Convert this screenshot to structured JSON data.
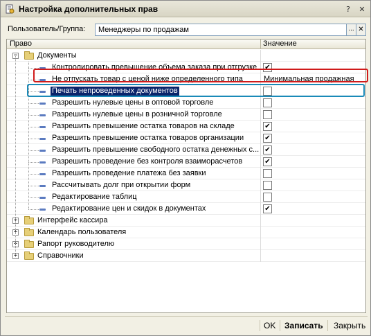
{
  "window": {
    "title": "Настройка дополнительных прав",
    "icon": "document-settings-icon"
  },
  "user": {
    "label": "Пользователь/Группа:",
    "value": "Менеджеры по продажам",
    "select_glyph": "...",
    "clear_glyph": "✕"
  },
  "grid": {
    "columns": [
      "Право",
      "Значение"
    ],
    "rows": [
      {
        "label": "Документы",
        "kind": "folder",
        "expanded": true
      },
      {
        "label": "Контролировать превышение объема заказа при отгрузке",
        "kind": "item",
        "checked": true
      },
      {
        "label": "Не отпускать товар с ценой ниже определенного типа",
        "kind": "item",
        "value": "Минимальная продажная"
      },
      {
        "label": "Печать непроведенных документов",
        "kind": "item",
        "checked": false,
        "selected": true
      },
      {
        "label": "Разрешить нулевые цены в оптовой торговле",
        "kind": "item",
        "checked": false
      },
      {
        "label": "Разрешить нулевые цены в розничной торговле",
        "kind": "item",
        "checked": false
      },
      {
        "label": "Разрешить превышение остатка товаров на складе",
        "kind": "item",
        "checked": true
      },
      {
        "label": "Разрешить превышение остатка товаров организации",
        "kind": "item",
        "checked": true
      },
      {
        "label": "Разрешить превышение свободного остатка денежных с...",
        "kind": "item",
        "checked": true
      },
      {
        "label": "Разрешить проведение без контроля взаиморасчетов",
        "kind": "item",
        "checked": true
      },
      {
        "label": "Разрешить проведение платежа без заявки",
        "kind": "item",
        "checked": false
      },
      {
        "label": "Рассчитывать долг при открытии форм",
        "kind": "item",
        "checked": false
      },
      {
        "label": "Редактирование таблиц",
        "kind": "item",
        "checked": false
      },
      {
        "label": "Редактирование цен и скидок в документах",
        "kind": "item",
        "checked": true
      },
      {
        "label": "Интерфейс кассира",
        "kind": "folder",
        "expanded": false
      },
      {
        "label": "Календарь пользователя",
        "kind": "folder",
        "expanded": false
      },
      {
        "label": "Рапорт руководителю",
        "kind": "folder",
        "expanded": false
      },
      {
        "label": "Справочники",
        "kind": "folder",
        "expanded": false
      }
    ]
  },
  "buttons": {
    "ok": "OK",
    "save": "Записать",
    "close": "Закрыть"
  },
  "glyphs": {
    "check": "✔",
    "minus": "−",
    "plus": "+",
    "help": "?",
    "close": "✕"
  },
  "colors": {
    "selection": "#0a246a",
    "highlight_red": "#d01a1a",
    "highlight_blue": "#1a8ab8"
  }
}
